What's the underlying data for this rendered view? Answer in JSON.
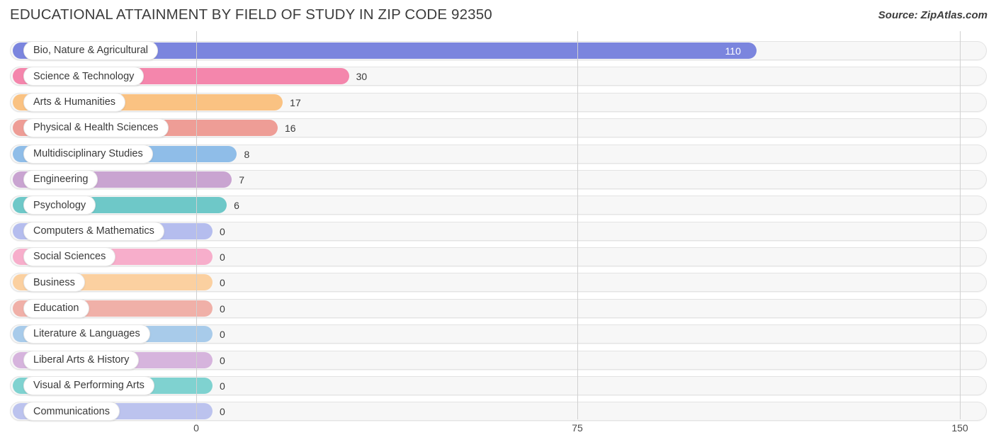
{
  "header": {
    "title": "EDUCATIONAL ATTAINMENT BY FIELD OF STUDY IN ZIP CODE 92350",
    "source": "Source: ZipAtlas.com"
  },
  "chart_data": {
    "type": "bar",
    "orientation": "horizontal",
    "title": "EDUCATIONAL ATTAINMENT BY FIELD OF STUDY IN ZIP CODE 92350",
    "subtitle": "",
    "xlabel": "",
    "ylabel": "",
    "xlim": [
      0,
      150
    ],
    "xticks": [
      0,
      75,
      150
    ],
    "xtick_labels": [
      "0",
      "75",
      "150"
    ],
    "grid": true,
    "legend": false,
    "categories": [
      "Bio, Nature & Agricultural",
      "Science & Technology",
      "Arts & Humanities",
      "Physical & Health Sciences",
      "Multidisciplinary Studies",
      "Engineering",
      "Psychology",
      "Computers & Mathematics",
      "Social Sciences",
      "Business",
      "Education",
      "Literature & Languages",
      "Liberal Arts & History",
      "Visual & Performing Arts",
      "Communications"
    ],
    "values": [
      110,
      30,
      17,
      16,
      8,
      7,
      6,
      0,
      0,
      0,
      0,
      0,
      0,
      0,
      0
    ],
    "value_labels": [
      "110",
      "30",
      "17",
      "16",
      "8",
      "7",
      "6",
      "0",
      "0",
      "0",
      "0",
      "0",
      "0",
      "0",
      "0"
    ],
    "colors": [
      "#7b85de",
      "#f486ac",
      "#fac282",
      "#ee9d96",
      "#8fbde8",
      "#c9a4d1",
      "#6ec8c8",
      "#b5bdee",
      "#f7aecb",
      "#fbd0a0",
      "#f0b0a8",
      "#a8cbea",
      "#d6b4dd",
      "#7fd2d0",
      "#bcc3ee"
    ]
  },
  "axis": {
    "ticks": [
      {
        "label": "0",
        "x": 277
      },
      {
        "label": "75",
        "x": 815
      },
      {
        "label": "150",
        "x": 1355
      }
    ]
  }
}
